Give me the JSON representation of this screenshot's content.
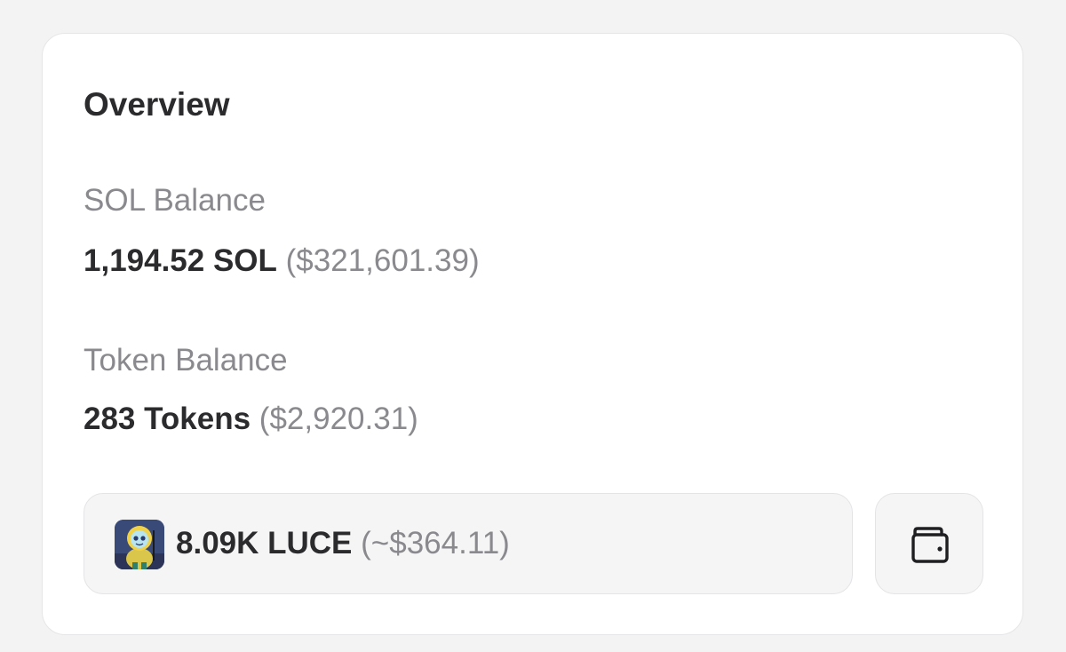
{
  "overview": {
    "title": "Overview"
  },
  "sol_balance": {
    "label": "SOL Balance",
    "amount": "1,194.52 SOL",
    "usd": "($321,601.39)"
  },
  "token_balance": {
    "label": "Token Balance",
    "amount": "283 Tokens",
    "usd": "($2,920.31)"
  },
  "selected_token": {
    "amount": "8.09K LUCE",
    "usd": "(~$364.11)",
    "avatar_icon": "token-avatar-luce"
  },
  "wallet_button": {
    "icon": "wallet-icon"
  }
}
